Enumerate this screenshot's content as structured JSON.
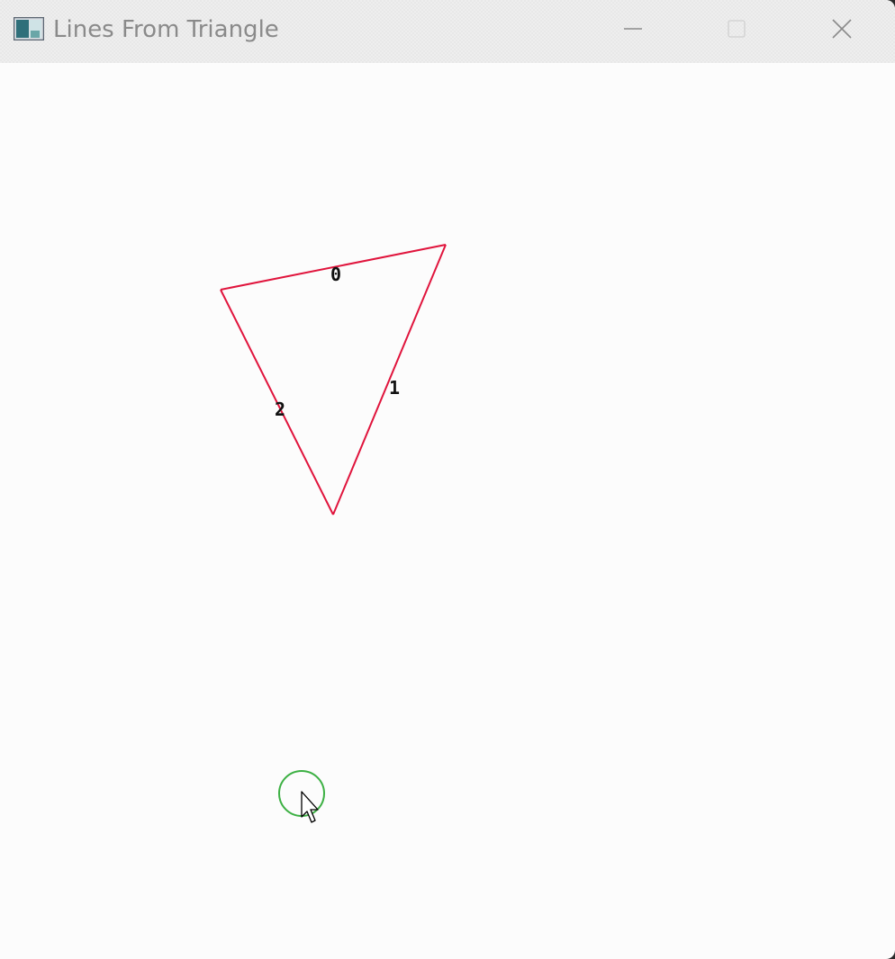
{
  "window": {
    "title": "Lines From Triangle",
    "controls": {
      "minimize_icon": "minimize-icon",
      "maximize_icon": "maximize-icon",
      "close_icon": "close-icon"
    }
  },
  "canvas": {
    "triangle": {
      "stroke_color": "#e0143c",
      "edge_labels": [
        "0",
        "1",
        "2"
      ]
    },
    "cursor_highlight": {
      "stroke_color": "#3cb043"
    },
    "cursor_icon": "arrow-cursor-icon"
  }
}
